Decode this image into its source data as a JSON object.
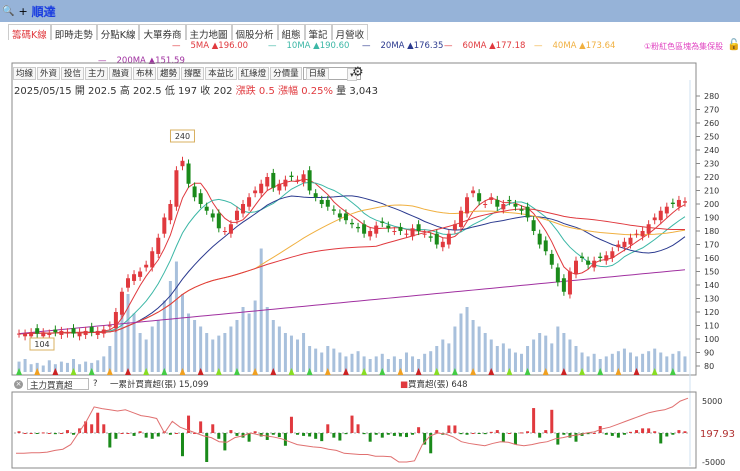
{
  "window": {
    "title": "順達",
    "add": "+"
  },
  "tabs": [
    "籌碼K線",
    "即時走勢",
    "分點K線",
    "大單券商",
    "主力地圖",
    "個股分析",
    "組態",
    "筆記",
    "月營收"
  ],
  "ma_legend": [
    {
      "label": "5MA ▲196.00",
      "color": "#e0393e"
    },
    {
      "label": "10MA ▲190.60",
      "color": "#3cb7a6"
    },
    {
      "label": "20MA ▲176.35",
      "color": "#2b3a8f"
    },
    {
      "label": "60MA ▲177.18",
      "color": "#e0393e"
    },
    {
      "label": "40MA ▲173.64",
      "color": "#f0b040"
    },
    {
      "label": "200MA ▲151.59",
      "color": "#a030a0"
    }
  ],
  "note": "①粉紅色區塊為集保股",
  "toolbar": [
    "均線",
    "外資",
    "投信",
    "主力",
    "融資",
    "布林",
    "趨勢",
    "撐壓",
    "本益比",
    "紅綠燈",
    "分價量"
  ],
  "period": "日線",
  "info": {
    "date": "2025/05/15",
    "open": "開 202.5",
    "high": "高 202.5",
    "low": "低 197",
    "close": "收 202",
    "change": "漲跌 0.5",
    "pct": "漲幅 0.25%",
    "vol": "量 3,043"
  },
  "price_axis": {
    "min": 80,
    "max": 280,
    "ticks": [
      "280",
      "270",
      "260",
      "250",
      "240",
      "230",
      "220",
      "210",
      "200",
      "190",
      "180",
      "170",
      "160",
      "150",
      "140",
      "130",
      "120",
      "110",
      "100",
      "90",
      "80"
    ]
  },
  "labels": {
    "high": "240",
    "low": "104"
  },
  "closes": [
    104,
    104,
    105,
    104,
    105,
    104,
    105,
    106,
    105,
    104,
    105,
    106,
    105,
    106,
    107,
    110,
    120,
    135,
    145,
    148,
    150,
    155,
    165,
    175,
    190,
    200,
    225,
    232,
    215,
    205,
    200,
    195,
    190,
    182,
    180,
    185,
    195,
    200,
    205,
    210,
    215,
    220,
    212,
    215,
    218,
    220,
    218,
    222,
    210,
    205,
    200,
    198,
    195,
    190,
    188,
    185,
    182,
    178,
    180,
    184,
    186,
    182,
    180,
    180,
    178,
    182,
    180,
    178,
    175,
    170,
    172,
    178,
    185,
    195,
    205,
    210,
    202,
    200,
    205,
    198,
    200,
    202,
    198,
    195,
    190,
    180,
    170,
    165,
    155,
    142,
    135,
    150,
    158,
    160,
    155,
    158,
    160,
    162,
    165,
    170,
    172,
    175,
    178,
    180,
    185,
    190,
    195,
    198,
    200,
    203,
    202
  ],
  "volumes": [
    8,
    10,
    6,
    7,
    5,
    9,
    6,
    8,
    7,
    10,
    6,
    8,
    7,
    9,
    12,
    20,
    40,
    55,
    60,
    45,
    30,
    25,
    35,
    40,
    55,
    70,
    85,
    60,
    45,
    40,
    35,
    30,
    25,
    28,
    30,
    35,
    40,
    50,
    45,
    55,
    95,
    50,
    40,
    35,
    30,
    28,
    25,
    30,
    20,
    18,
    15,
    20,
    18,
    15,
    12,
    14,
    16,
    12,
    10,
    12,
    14,
    10,
    12,
    10,
    15,
    12,
    10,
    14,
    16,
    20,
    25,
    22,
    35,
    45,
    50,
    40,
    35,
    30,
    25,
    20,
    22,
    18,
    15,
    14,
    20,
    25,
    30,
    28,
    22,
    35,
    30,
    25,
    20,
    15,
    12,
    14,
    10,
    12,
    14,
    16,
    18,
    15,
    12,
    14,
    16,
    18,
    15,
    12,
    14,
    16,
    12
  ],
  "lower": {
    "selector": "主力買賣超",
    "help": "?",
    "cum_label": "一累計買賣超(張) 15,099",
    "bar_label": "買賣超(張) 648",
    "axis": [
      "5000",
      "-5000"
    ],
    "price_tag": "197.93",
    "net": [
      300,
      0,
      0,
      -100,
      100,
      0,
      -200,
      0,
      500,
      -300,
      800,
      2000,
      1500,
      3500,
      1500,
      -2500,
      -1000,
      0,
      0,
      -500,
      300,
      -800,
      -1000,
      -600,
      300,
      -300,
      0,
      -4000,
      3000,
      0,
      2000,
      -5000,
      1500,
      -1000,
      -3000,
      500,
      -500,
      -800,
      -1500,
      300,
      -600,
      -1200,
      -300,
      -700,
      -2200,
      2800,
      -300,
      -500,
      -600,
      -1000,
      -1400,
      1500,
      -800,
      -1300,
      -200,
      3000,
      1500,
      -200,
      -1500,
      -300,
      -800,
      -300,
      -500,
      -600,
      -700,
      -300,
      1000,
      -2000,
      -3500,
      500,
      -300,
      1300,
      1300,
      -200,
      -300,
      0,
      -100,
      -200,
      200,
      500,
      -1500,
      0,
      -2000,
      100,
      300,
      4300,
      -800,
      500,
      4000,
      -2000,
      -300,
      -800,
      -1500,
      -500,
      -200,
      0,
      1200,
      -300,
      -500,
      -800,
      -300,
      200,
      500,
      800,
      800,
      300,
      -1800,
      -600,
      -300,
      500,
      300
    ],
    "cum": [
      -3500,
      -3500,
      -3400,
      -3400,
      -3300,
      -3000,
      -2800,
      -2000,
      0,
      2000,
      4500,
      4200,
      4000,
      3800,
      4000,
      3500,
      3000,
      2800,
      2500,
      0,
      2000,
      1000,
      500,
      0,
      -500,
      -800,
      -1500,
      -1600,
      -800,
      -500,
      0,
      -300,
      -500,
      -700,
      -1000,
      -1500,
      -2000,
      -2200,
      -2400,
      -2500,
      -2800,
      -3000,
      -3500,
      -3600,
      -3700,
      -3700,
      -4000,
      -4000,
      -4100,
      -5000,
      -5000,
      -4800,
      -2000,
      -500,
      0,
      -200,
      -700,
      -1500,
      -1800,
      -2000,
      -2200,
      -1800,
      -1500,
      -1600,
      -2000,
      -2200,
      -2000,
      -1700,
      -1500,
      -1000,
      -800,
      -500,
      -300,
      0,
      200,
      700,
      1000,
      1500,
      2000,
      2500,
      3000,
      3500,
      3800,
      4000,
      4500,
      5500,
      6000
    ]
  }
}
